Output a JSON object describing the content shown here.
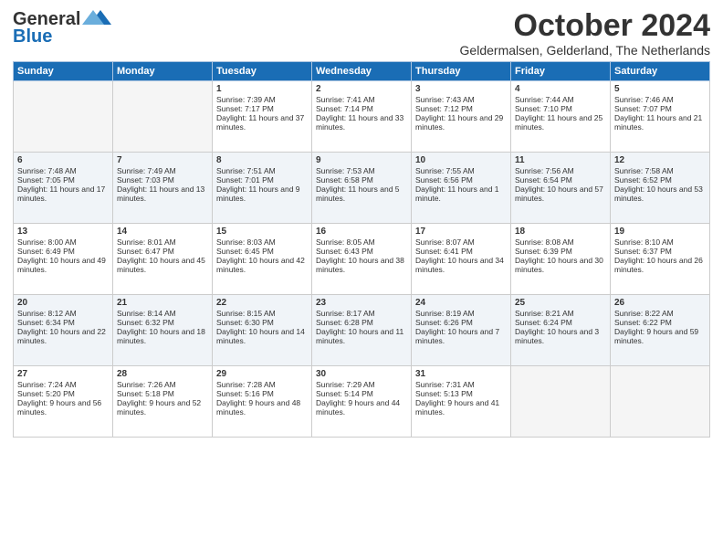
{
  "header": {
    "logo_line1": "General",
    "logo_line2": "Blue",
    "month": "October 2024",
    "location": "Geldermalsen, Gelderland, The Netherlands"
  },
  "weekdays": [
    "Sunday",
    "Monday",
    "Tuesday",
    "Wednesday",
    "Thursday",
    "Friday",
    "Saturday"
  ],
  "weeks": [
    [
      {
        "day": "",
        "content": ""
      },
      {
        "day": "",
        "content": ""
      },
      {
        "day": "1",
        "content": "Sunrise: 7:39 AM\nSunset: 7:17 PM\nDaylight: 11 hours and 37 minutes."
      },
      {
        "day": "2",
        "content": "Sunrise: 7:41 AM\nSunset: 7:14 PM\nDaylight: 11 hours and 33 minutes."
      },
      {
        "day": "3",
        "content": "Sunrise: 7:43 AM\nSunset: 7:12 PM\nDaylight: 11 hours and 29 minutes."
      },
      {
        "day": "4",
        "content": "Sunrise: 7:44 AM\nSunset: 7:10 PM\nDaylight: 11 hours and 25 minutes."
      },
      {
        "day": "5",
        "content": "Sunrise: 7:46 AM\nSunset: 7:07 PM\nDaylight: 11 hours and 21 minutes."
      }
    ],
    [
      {
        "day": "6",
        "content": "Sunrise: 7:48 AM\nSunset: 7:05 PM\nDaylight: 11 hours and 17 minutes."
      },
      {
        "day": "7",
        "content": "Sunrise: 7:49 AM\nSunset: 7:03 PM\nDaylight: 11 hours and 13 minutes."
      },
      {
        "day": "8",
        "content": "Sunrise: 7:51 AM\nSunset: 7:01 PM\nDaylight: 11 hours and 9 minutes."
      },
      {
        "day": "9",
        "content": "Sunrise: 7:53 AM\nSunset: 6:58 PM\nDaylight: 11 hours and 5 minutes."
      },
      {
        "day": "10",
        "content": "Sunrise: 7:55 AM\nSunset: 6:56 PM\nDaylight: 11 hours and 1 minute."
      },
      {
        "day": "11",
        "content": "Sunrise: 7:56 AM\nSunset: 6:54 PM\nDaylight: 10 hours and 57 minutes."
      },
      {
        "day": "12",
        "content": "Sunrise: 7:58 AM\nSunset: 6:52 PM\nDaylight: 10 hours and 53 minutes."
      }
    ],
    [
      {
        "day": "13",
        "content": "Sunrise: 8:00 AM\nSunset: 6:49 PM\nDaylight: 10 hours and 49 minutes."
      },
      {
        "day": "14",
        "content": "Sunrise: 8:01 AM\nSunset: 6:47 PM\nDaylight: 10 hours and 45 minutes."
      },
      {
        "day": "15",
        "content": "Sunrise: 8:03 AM\nSunset: 6:45 PM\nDaylight: 10 hours and 42 minutes."
      },
      {
        "day": "16",
        "content": "Sunrise: 8:05 AM\nSunset: 6:43 PM\nDaylight: 10 hours and 38 minutes."
      },
      {
        "day": "17",
        "content": "Sunrise: 8:07 AM\nSunset: 6:41 PM\nDaylight: 10 hours and 34 minutes."
      },
      {
        "day": "18",
        "content": "Sunrise: 8:08 AM\nSunset: 6:39 PM\nDaylight: 10 hours and 30 minutes."
      },
      {
        "day": "19",
        "content": "Sunrise: 8:10 AM\nSunset: 6:37 PM\nDaylight: 10 hours and 26 minutes."
      }
    ],
    [
      {
        "day": "20",
        "content": "Sunrise: 8:12 AM\nSunset: 6:34 PM\nDaylight: 10 hours and 22 minutes."
      },
      {
        "day": "21",
        "content": "Sunrise: 8:14 AM\nSunset: 6:32 PM\nDaylight: 10 hours and 18 minutes."
      },
      {
        "day": "22",
        "content": "Sunrise: 8:15 AM\nSunset: 6:30 PM\nDaylight: 10 hours and 14 minutes."
      },
      {
        "day": "23",
        "content": "Sunrise: 8:17 AM\nSunset: 6:28 PM\nDaylight: 10 hours and 11 minutes."
      },
      {
        "day": "24",
        "content": "Sunrise: 8:19 AM\nSunset: 6:26 PM\nDaylight: 10 hours and 7 minutes."
      },
      {
        "day": "25",
        "content": "Sunrise: 8:21 AM\nSunset: 6:24 PM\nDaylight: 10 hours and 3 minutes."
      },
      {
        "day": "26",
        "content": "Sunrise: 8:22 AM\nSunset: 6:22 PM\nDaylight: 9 hours and 59 minutes."
      }
    ],
    [
      {
        "day": "27",
        "content": "Sunrise: 7:24 AM\nSunset: 5:20 PM\nDaylight: 9 hours and 56 minutes."
      },
      {
        "day": "28",
        "content": "Sunrise: 7:26 AM\nSunset: 5:18 PM\nDaylight: 9 hours and 52 minutes."
      },
      {
        "day": "29",
        "content": "Sunrise: 7:28 AM\nSunset: 5:16 PM\nDaylight: 9 hours and 48 minutes."
      },
      {
        "day": "30",
        "content": "Sunrise: 7:29 AM\nSunset: 5:14 PM\nDaylight: 9 hours and 44 minutes."
      },
      {
        "day": "31",
        "content": "Sunrise: 7:31 AM\nSunset: 5:13 PM\nDaylight: 9 hours and 41 minutes."
      },
      {
        "day": "",
        "content": ""
      },
      {
        "day": "",
        "content": ""
      }
    ]
  ]
}
